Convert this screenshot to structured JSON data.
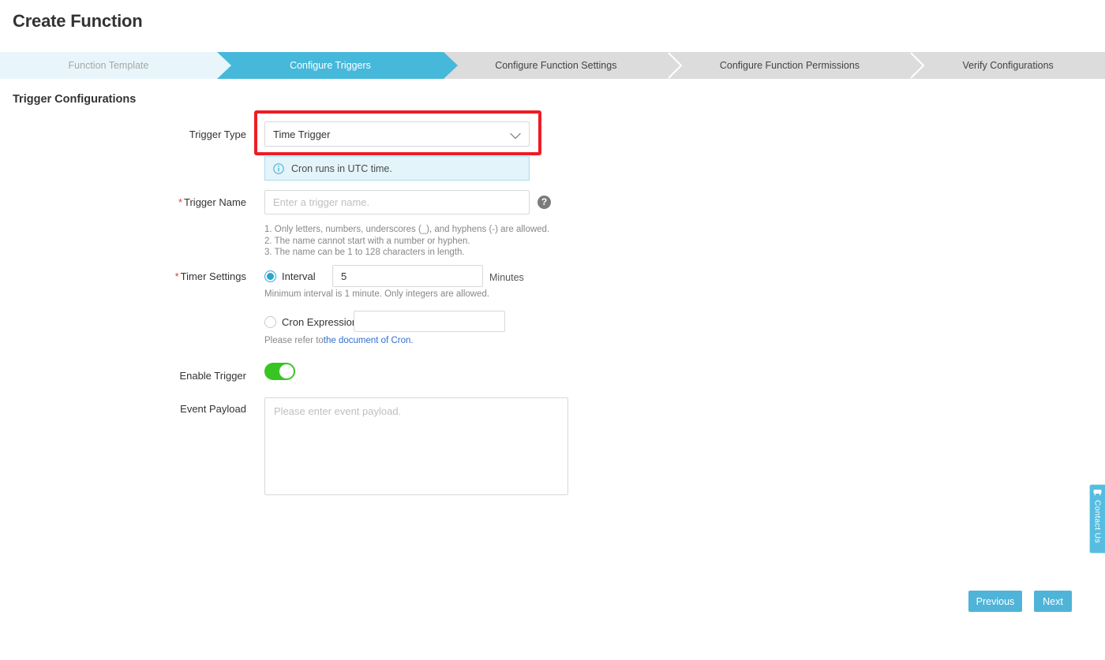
{
  "page": {
    "title": "Create Function",
    "section_title": "Trigger Configurations"
  },
  "steps": [
    {
      "label": "Function Template",
      "state": "done"
    },
    {
      "label": "Configure Triggers",
      "state": "active"
    },
    {
      "label": "Configure Function Settings",
      "state": "todo"
    },
    {
      "label": "Configure Function Permissions",
      "state": "todo"
    },
    {
      "label": "Verify Configurations",
      "state": "todo"
    }
  ],
  "form": {
    "trigger_type": {
      "label": "Trigger Type",
      "value": "Time Trigger",
      "icon": "chevron-down-icon",
      "highlighted": true
    },
    "info_notice": {
      "icon": "info-circle-icon",
      "text": "Cron runs in UTC time."
    },
    "trigger_name": {
      "label": "Trigger Name",
      "required": true,
      "required_marker": "*",
      "value": "",
      "placeholder": "Enter a trigger name.",
      "help_icon": "question-mark-icon",
      "help_glyph": "?",
      "hints": [
        "1. Only letters, numbers, underscores (_), and hyphens (-) are allowed.",
        "2. The name cannot start with a number or hyphen.",
        "3. The name can be 1 to 128 characters in length."
      ]
    },
    "timer_settings": {
      "label": "Timer Settings",
      "required": true,
      "required_marker": "*",
      "selected_mode": "interval",
      "interval": {
        "radio_label": "Interval",
        "value": "5",
        "unit": "Minutes",
        "note": "Minimum interval is 1 minute. Only integers are allowed."
      },
      "cron": {
        "radio_label": "Cron Expression",
        "value": "",
        "placeholder": "",
        "note_prefix": "Please refer to",
        "note_link": "the document of Cron."
      }
    },
    "enable_trigger": {
      "label": "Enable Trigger",
      "state": "on"
    },
    "event_payload": {
      "label": "Event Payload",
      "value": "",
      "placeholder": "Please enter event payload."
    }
  },
  "footer": {
    "previous_label": "Previous",
    "next_label": "Next"
  },
  "contact_tab": {
    "label": "Contact Us",
    "icon": "headset-icon"
  },
  "colors": {
    "accent": "#46b8da",
    "step_done_bg": "#e8f6fb",
    "step_todo_bg": "#dcdcdc",
    "highlight_red": "#ee1c25",
    "toggle_on": "#38c522",
    "link": "#2f6fd0",
    "required_red": "#e4393c"
  }
}
